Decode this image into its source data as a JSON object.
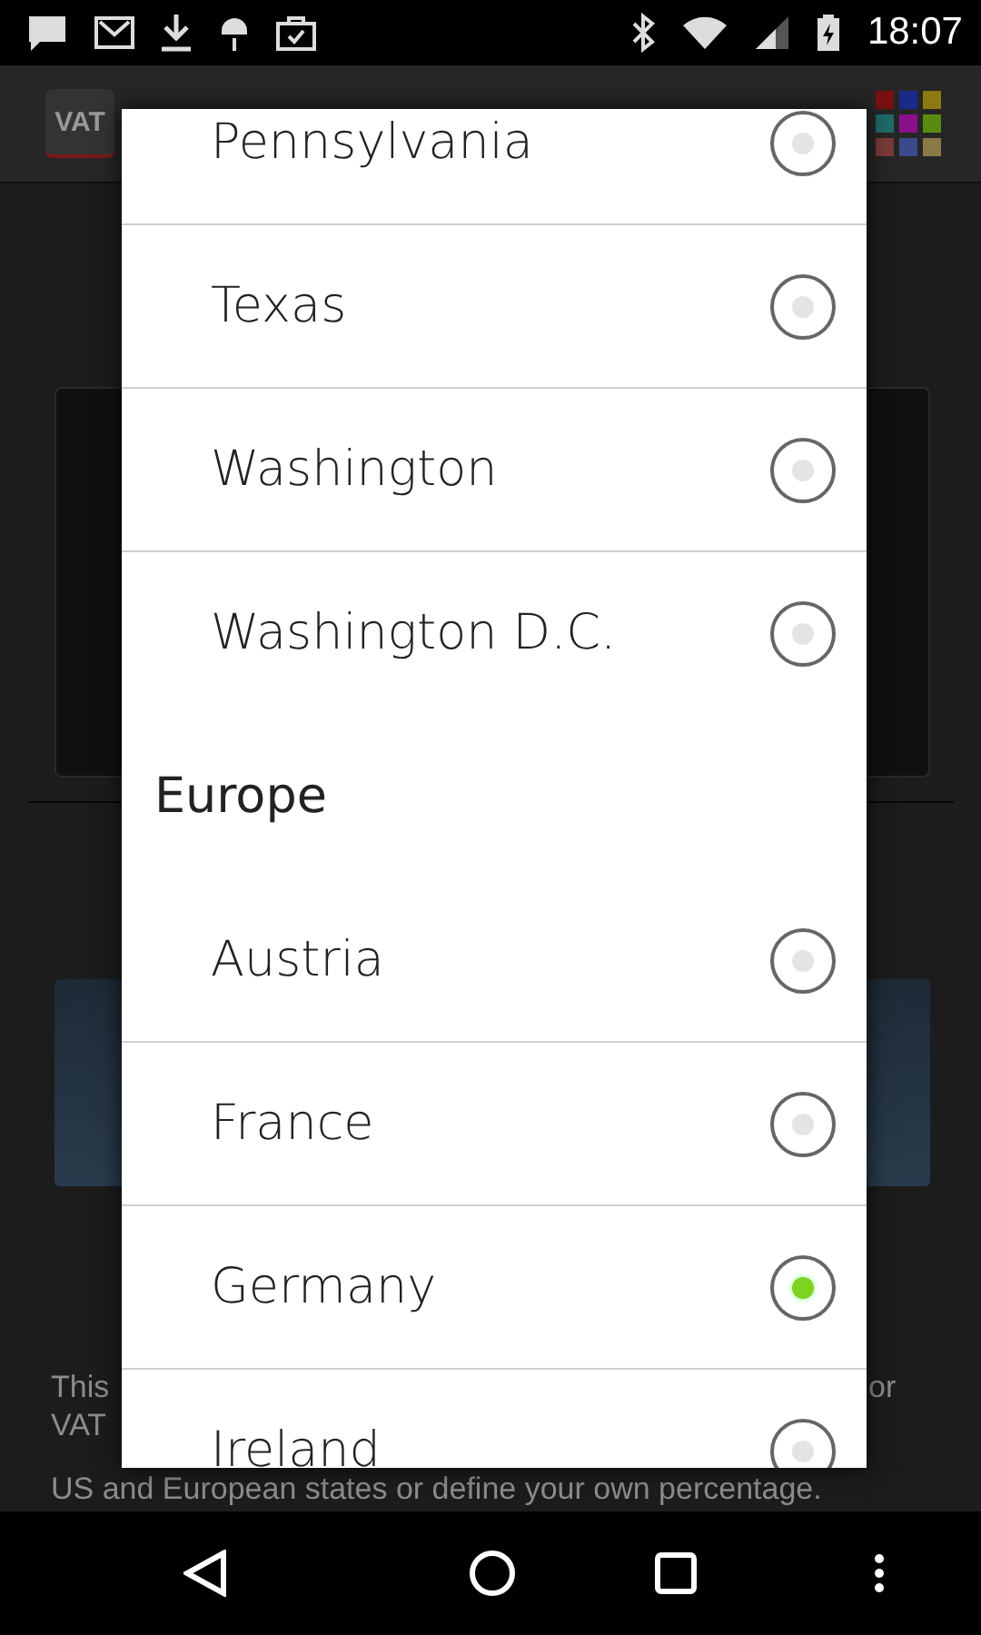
{
  "status_bar": {
    "time": "18:07"
  },
  "app_bar": {
    "icon_text": "VAT"
  },
  "background": {
    "line_1_start": "This",
    "line_1_end": "or",
    "line_2_start": "VAT",
    "line_4": "US and European states or define your own percentage."
  },
  "dialog": {
    "items": [
      {
        "kind": "option",
        "label": "Pennsylvania",
        "selected": false
      },
      {
        "kind": "option",
        "label": "Texas",
        "selected": false
      },
      {
        "kind": "option",
        "label": "Washington",
        "selected": false
      },
      {
        "kind": "option",
        "label": "Washington D.C.",
        "selected": false
      },
      {
        "kind": "header",
        "label": "Europe"
      },
      {
        "kind": "option",
        "label": "Austria",
        "selected": false
      },
      {
        "kind": "option",
        "label": "France",
        "selected": false
      },
      {
        "kind": "option",
        "label": "Germany",
        "selected": true
      },
      {
        "kind": "option",
        "label": "Ireland",
        "selected": false
      }
    ]
  }
}
